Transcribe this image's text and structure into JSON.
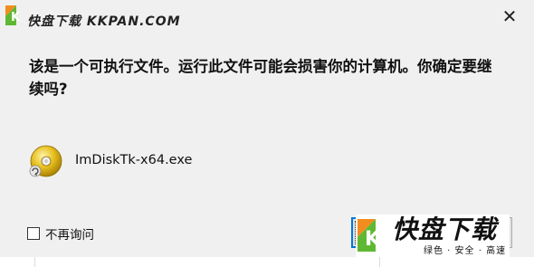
{
  "titlebar": {
    "title": "快盘下载 KKPAN.COM",
    "close_icon": "close-icon"
  },
  "message": {
    "text": "该是一个可执行文件。运行此文件可能会损害你的计算机。你确定要继续吗?"
  },
  "file": {
    "icon": "disc-executable-icon",
    "name": "ImDiskTk-x64.exe"
  },
  "checkbox": {
    "label": "不再询问",
    "checked": false
  },
  "buttons": {
    "run_label": "",
    "cancel_label": ""
  },
  "watermark": {
    "text": "快盘下载",
    "subtitle": "绿色 · 安全 · 高速",
    "colors": {
      "green": "#5fb832",
      "orange": "#f28c1e"
    }
  }
}
